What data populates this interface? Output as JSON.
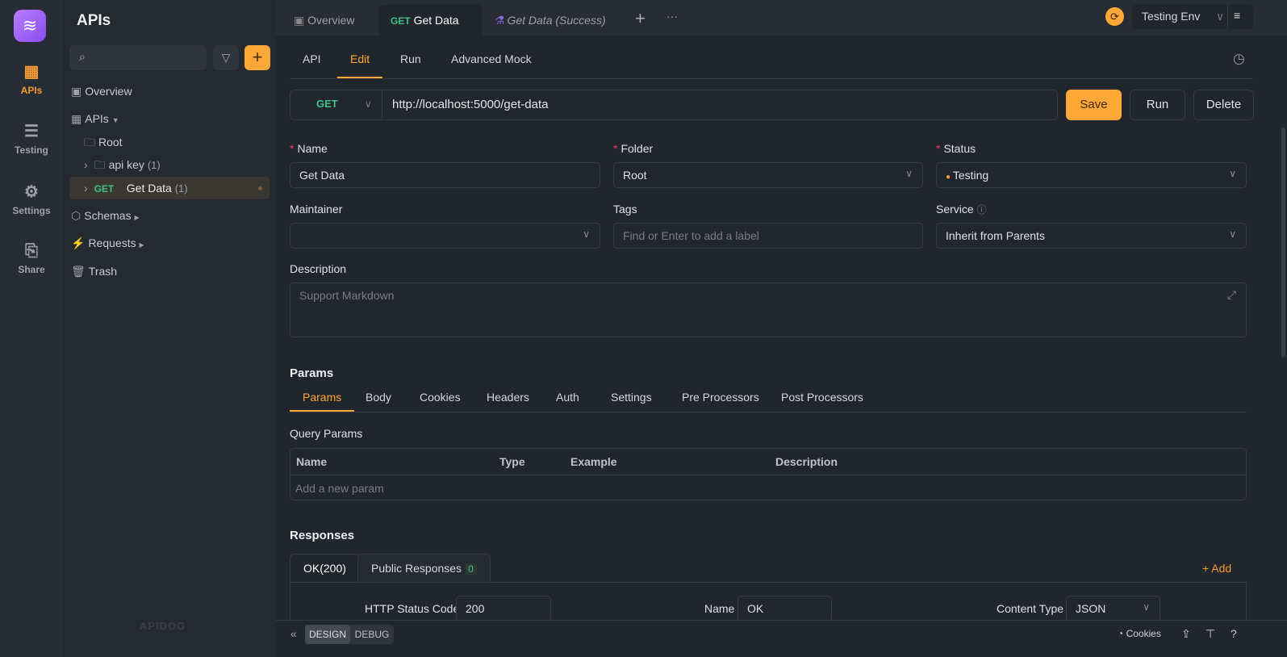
{
  "rail": {
    "items": [
      {
        "label": "APIs",
        "icon": "apis-icon"
      },
      {
        "label": "Testing",
        "icon": "testing-icon"
      },
      {
        "label": "Settings",
        "icon": "settings-icon"
      },
      {
        "label": "Share",
        "icon": "share-icon"
      }
    ]
  },
  "sidebar": {
    "title": "APIs",
    "tree": [
      {
        "label": "Overview"
      },
      {
        "label": "APIs"
      },
      {
        "label": "Root"
      },
      {
        "label": "api key",
        "count": "(1)"
      },
      {
        "method": "GET",
        "label": "Get Data",
        "count": "(1)"
      },
      {
        "label": "Schemas"
      },
      {
        "label": "Requests"
      },
      {
        "label": "Trash"
      }
    ],
    "brand": "APIDOG"
  },
  "tabs": [
    {
      "label": "Overview"
    },
    {
      "method": "GET",
      "label": "Get Data"
    },
    {
      "label": "Get Data (Success)"
    }
  ],
  "env": {
    "label": "Testing Env"
  },
  "subtabs": [
    "API",
    "Edit",
    "Run",
    "Advanced Mock"
  ],
  "request": {
    "method": "GET",
    "url": "http://localhost:5000/get-data",
    "save": "Save",
    "run": "Run",
    "delete": "Delete"
  },
  "form": {
    "name": {
      "label": "Name",
      "value": "Get Data"
    },
    "folder": {
      "label": "Folder",
      "value": "Root"
    },
    "status": {
      "label": "Status",
      "value": "Testing",
      "color": "#f39a33"
    },
    "maintainer": {
      "label": "Maintainer",
      "value": ""
    },
    "tags": {
      "label": "Tags",
      "placeholder": "Find or Enter to add a label"
    },
    "service": {
      "label": "Service",
      "value": "Inherit from Parents"
    },
    "description": {
      "label": "Description",
      "placeholder": "Support Markdown"
    }
  },
  "params": {
    "title": "Params",
    "tabs": [
      "Params",
      "Body",
      "Cookies",
      "Headers",
      "Auth",
      "Settings",
      "Pre Processors",
      "Post Processors"
    ],
    "query_title": "Query Params",
    "columns": [
      "Name",
      "Type",
      "Example",
      "Description"
    ],
    "add_placeholder": "Add a new param"
  },
  "responses": {
    "title": "Responses",
    "tabs": [
      {
        "label": "OK(200)"
      },
      {
        "label": "Public Responses",
        "count": "0"
      }
    ],
    "add": "+ Add",
    "status_code_label": "HTTP Status Code",
    "status_code": "200",
    "name_label": "Name",
    "name": "OK",
    "content_type_label": "Content Type",
    "content_type": "JSON"
  },
  "footer": {
    "design": "DESIGN",
    "debug": "DEBUG",
    "cookies": "Cookies"
  }
}
